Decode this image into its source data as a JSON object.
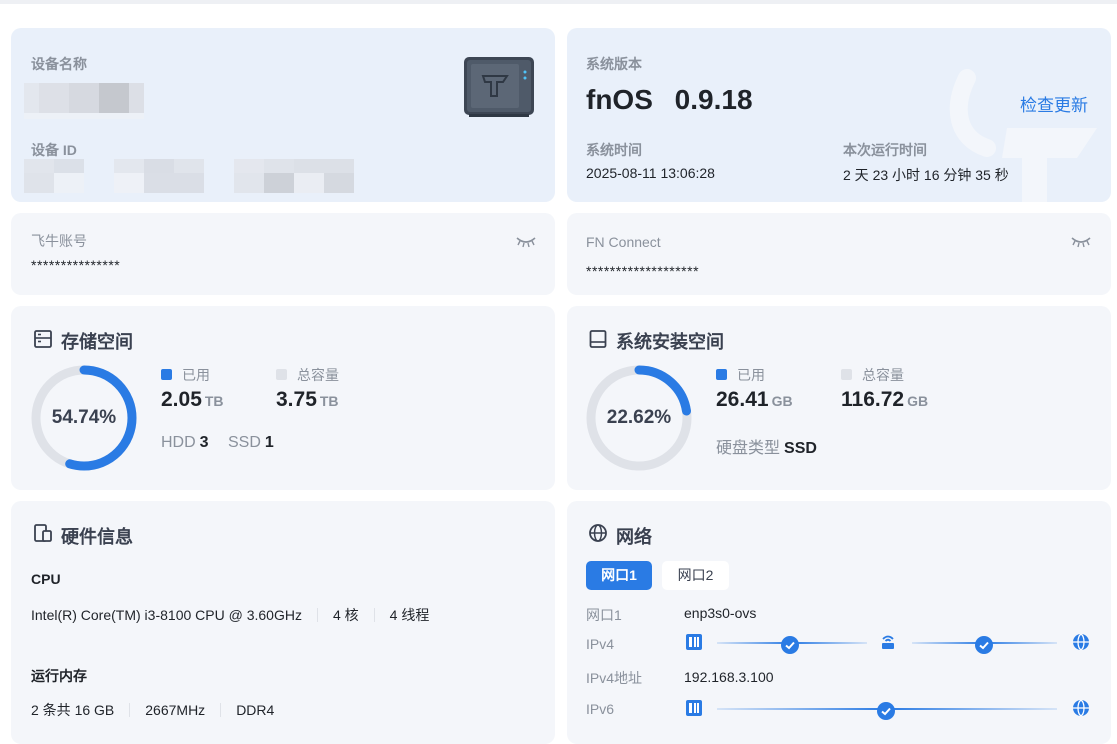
{
  "device": {
    "name_label": "设备名称",
    "id_label": "设备 ID"
  },
  "system": {
    "version_label": "系统版本",
    "os_name": "fnOS",
    "version": "0.9.18",
    "check_update": "检查更新",
    "time_label": "系统时间",
    "time_value": "2025-08-11 13:06:28",
    "uptime_label": "本次运行时间",
    "uptime_value": "2 天 23 小时 16 分钟 35 秒"
  },
  "account": {
    "label": "飞牛账号",
    "value": "***************"
  },
  "fn_connect": {
    "label": "FN Connect",
    "value": "*******************"
  },
  "storage": {
    "title": "存储空间",
    "percent": "54.74%",
    "percent_value": 54.74,
    "used_label": "已用",
    "used_value": "2.05",
    "used_unit": "TB",
    "total_label": "总容量",
    "total_value": "3.75",
    "total_unit": "TB",
    "hdd_label": "HDD",
    "hdd_count": "3",
    "ssd_label": "SSD",
    "ssd_count": "1"
  },
  "system_space": {
    "title": "系统安装空间",
    "percent": "22.62%",
    "percent_value": 22.62,
    "used_label": "已用",
    "used_value": "26.41",
    "used_unit": "GB",
    "total_label": "总容量",
    "total_value": "116.72",
    "total_unit": "GB",
    "disk_type_label": "硬盘类型",
    "disk_type_value": "SSD"
  },
  "hardware": {
    "title": "硬件信息",
    "cpu_label": "CPU",
    "cpu_model": "Intel(R) Core(TM) i3-8100 CPU @ 3.60GHz",
    "cpu_cores": "4 核",
    "cpu_threads": "4 线程",
    "mem_label": "运行内存",
    "mem_total": "2 条共 16 GB",
    "mem_speed": "2667MHz",
    "mem_type": "DDR4"
  },
  "network": {
    "title": "网络",
    "tabs": [
      "网口1",
      "网口2"
    ],
    "port_label": "网口1",
    "port_value": "enp3s0-ovs",
    "ipv4_label": "IPv4",
    "ipv4_addr_label": "IPv4地址",
    "ipv4_addr_value": "192.168.3.100",
    "ipv6_label": "IPv6"
  },
  "colors": {
    "accent": "#2a7be4",
    "ring_track": "#dfe2e8",
    "card_bg": "#f4f6fa",
    "card_blue_bg": "#e9f0fa",
    "label": "#8a919c"
  },
  "icons": {
    "storage": "storage-icon",
    "system_space": "hard-drive-icon",
    "hardware": "devices-icon",
    "network": "globe-icon",
    "eye_closed": "eye-closed-icon"
  }
}
